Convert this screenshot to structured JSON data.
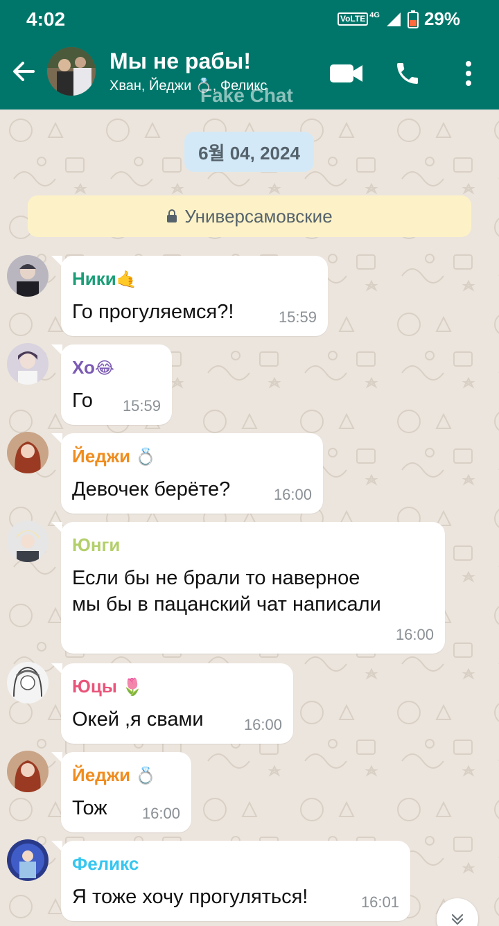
{
  "status_bar": {
    "time": "4:02",
    "volte": "VoLTE",
    "network": "4G",
    "battery": "29%"
  },
  "header": {
    "title": "Мы не рабы!",
    "members": "Хван, Йеджи 💍, Феликс",
    "watermark": "Fake Chat",
    "icons": {
      "back": "back-arrow-icon",
      "video": "video-call-icon",
      "call": "phone-icon",
      "menu": "more-options-icon"
    }
  },
  "chat": {
    "date": "6월 04, 2024",
    "group_label": "Универсамовские",
    "messages": [
      {
        "sender": "Ники",
        "sender_emoji": "🤙",
        "sender_color": "#1a9e77",
        "text_lines": [
          "Го прогуляемся?!"
        ],
        "time": "15:59"
      },
      {
        "sender": "Хо",
        "sender_emoji": "😂",
        "sender_color": "#7b5ab4",
        "text_lines": [
          "Го"
        ],
        "time": "15:59"
      },
      {
        "sender": "Йеджи",
        "sender_emoji": "💍",
        "sender_color": "#f08c1e",
        "text_lines": [
          "Девочек берёте?"
        ],
        "time": "16:00"
      },
      {
        "sender": "Юнги",
        "sender_emoji": "",
        "sender_color": "#b3cf6a",
        "text_lines": [
          "Если бы не брали то наверное",
          "мы бы в пацанский чат написали"
        ],
        "time": "16:00"
      },
      {
        "sender": "Юцы",
        "sender_emoji": "🌷",
        "sender_color": "#e9557a",
        "text_lines": [
          "Окей ,я свами"
        ],
        "time": "16:00"
      },
      {
        "sender": "Йеджи",
        "sender_emoji": "💍",
        "sender_color": "#f08c1e",
        "text_lines": [
          "Тож"
        ],
        "time": "16:00"
      },
      {
        "sender": "Феликс",
        "sender_emoji": "",
        "sender_color": "#36c6f0",
        "text_lines": [
          "Я тоже хочу прогуляться!"
        ],
        "time": "16:01"
      }
    ]
  },
  "colors": {
    "header": "#00766a",
    "chat_bg": "#ece5dd",
    "date_chip": "#d4e9f7",
    "notice_chip": "#fdf2c7",
    "bubble": "#ffffff"
  }
}
